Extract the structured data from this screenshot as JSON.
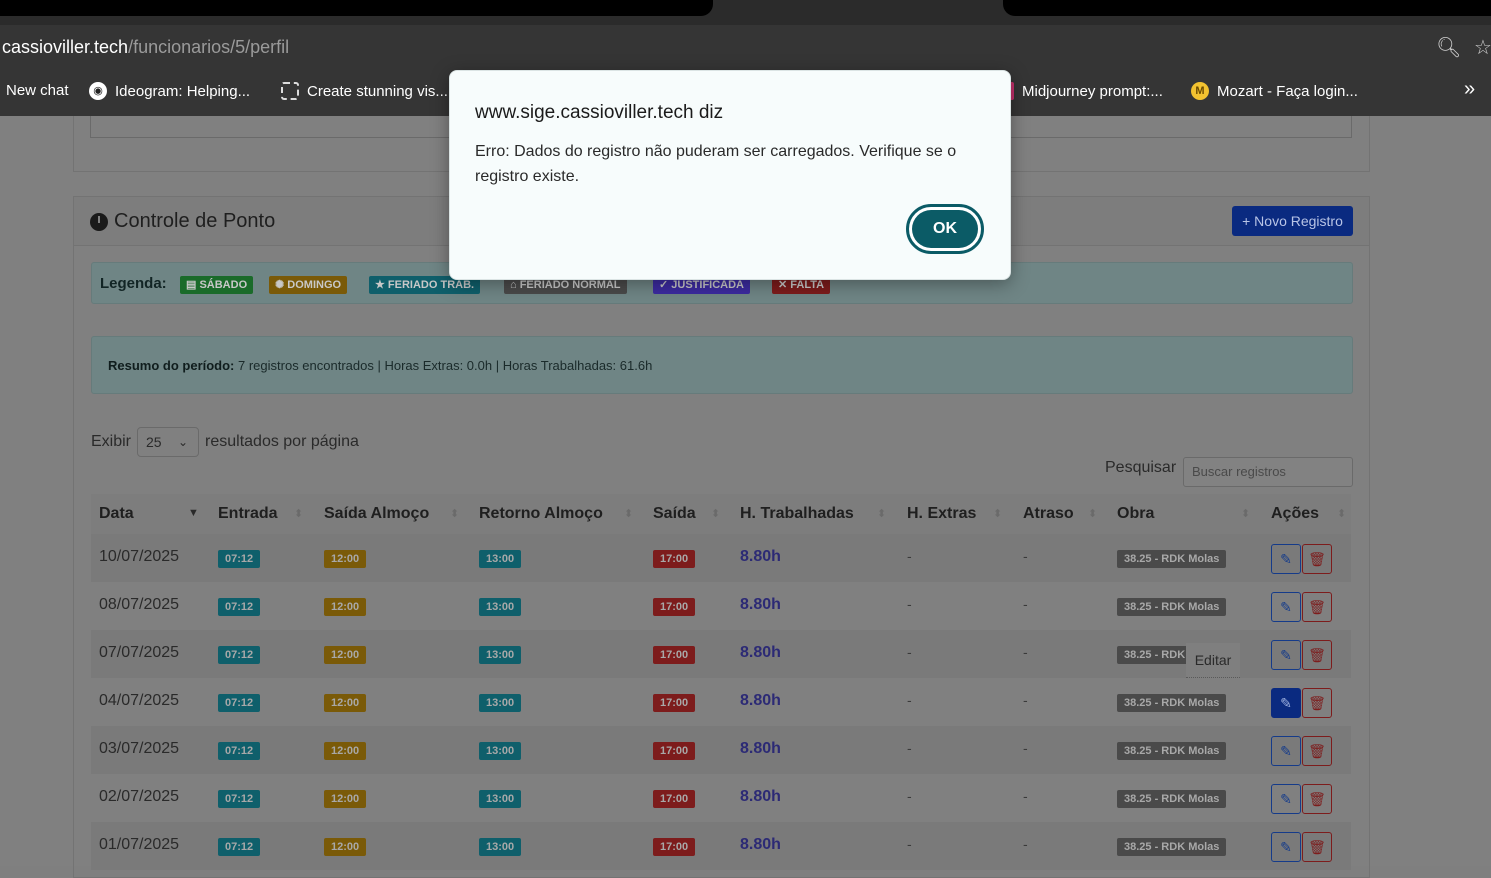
{
  "browser": {
    "url_host": "cassioviller.tech",
    "url_path": "/funcionarios/5/perfil",
    "bookmarks": [
      {
        "label": "New chat"
      },
      {
        "label": "Ideogram: Helping..."
      },
      {
        "label": "Create stunning vis..."
      },
      {
        "label": "Midjourney prompt:..."
      },
      {
        "label": "Mozart - Faça login..."
      }
    ],
    "more": "»"
  },
  "card": {
    "title": "Controle de Ponto",
    "new_button": "+ Novo Registro"
  },
  "legend": {
    "label": "Legenda:",
    "badges": [
      {
        "label": "SÁBADO",
        "color": "#1a6b2a"
      },
      {
        "label": "DOMINGO",
        "color": "#7a5a08"
      },
      {
        "label": "FERIADO TRAB.",
        "color": "#0f5f6b"
      },
      {
        "label": "FERIADO NORMAL",
        "color": "#4a4a4a"
      },
      {
        "label": "JUSTIFICADA",
        "color": "#3c2ba0"
      },
      {
        "label": "FALTA",
        "color": "#7d1c1c"
      }
    ]
  },
  "summary": {
    "label": "Resumo do período:",
    "text": " 7 registros encontrados | Horas Extras: 0.0h | Horas Trabalhadas: 61.6h"
  },
  "controls": {
    "show_label": "Exibir",
    "page_size": "25",
    "per_page_label": "resultados por página",
    "search_label": "Pesquisar",
    "search_placeholder": "Buscar registros"
  },
  "table": {
    "headers": [
      "Data",
      "Entrada",
      "Saída Almoço",
      "Retorno Almoço",
      "Saída",
      "H. Trabalhadas",
      "H. Extras",
      "Atraso",
      "Obra",
      "Ações"
    ],
    "rows": [
      {
        "data": "10/07/2025",
        "entrada": "07:12",
        "saida_almoco": "12:00",
        "retorno": "13:00",
        "saida": "17:00",
        "horas": "8.80h",
        "extras": "-",
        "atraso": "-",
        "obra": "38.25 - RDK Molas"
      },
      {
        "data": "08/07/2025",
        "entrada": "07:12",
        "saida_almoco": "12:00",
        "retorno": "13:00",
        "saida": "17:00",
        "horas": "8.80h",
        "extras": "-",
        "atraso": "-",
        "obra": "38.25 - RDK Molas"
      },
      {
        "data": "07/07/2025",
        "entrada": "07:12",
        "saida_almoco": "12:00",
        "retorno": "13:00",
        "saida": "17:00",
        "horas": "8.80h",
        "extras": "-",
        "atraso": "-",
        "obra": "38.25 - RDK Molas"
      },
      {
        "data": "04/07/2025",
        "entrada": "07:12",
        "saida_almoco": "12:00",
        "retorno": "13:00",
        "saida": "17:00",
        "horas": "8.80h",
        "extras": "-",
        "atraso": "-",
        "obra": "38.25 - RDK Molas"
      },
      {
        "data": "03/07/2025",
        "entrada": "07:12",
        "saida_almoco": "12:00",
        "retorno": "13:00",
        "saida": "17:00",
        "horas": "8.80h",
        "extras": "-",
        "atraso": "-",
        "obra": "38.25 - RDK Molas"
      },
      {
        "data": "02/07/2025",
        "entrada": "07:12",
        "saida_almoco": "12:00",
        "retorno": "13:00",
        "saida": "17:00",
        "horas": "8.80h",
        "extras": "-",
        "atraso": "-",
        "obra": "38.25 - RDK Molas"
      },
      {
        "data": "01/07/2025",
        "entrada": "07:12",
        "saida_almoco": "12:00",
        "retorno": "13:00",
        "saida": "17:00",
        "horas": "8.80h",
        "extras": "-",
        "atraso": "-",
        "obra": "38.25 - RDK Molas"
      }
    ],
    "tooltip": "Editar"
  },
  "dialog": {
    "title": "www.sige.cassioviller.tech diz",
    "message": "Erro: Dados do registro não puderam ser carregados. Verifique se o registro existe.",
    "ok_label": "OK"
  }
}
